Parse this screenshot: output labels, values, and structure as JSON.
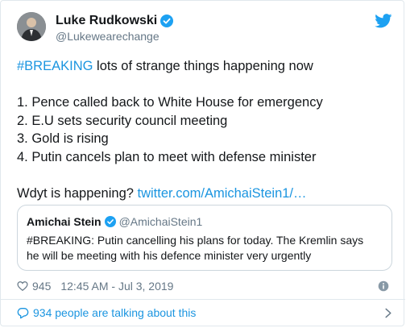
{
  "author": {
    "display_name": "Luke Rudkowski",
    "handle": "@Lukewearechange"
  },
  "tweet": {
    "hashtag": "#BREAKING",
    "lead_rest": " lots of strange things happening now",
    "items": [
      "1. Pence called back to White House for emergency",
      "2. E.U sets security council meeting",
      "3. Gold is rising",
      "4. Putin cancels plan to meet with defense minister"
    ],
    "question": "Wdyt is happening? ",
    "link": "twitter.com/AmichaiStein1/…"
  },
  "quoted_tweet": {
    "display_name": "Amichai Stein",
    "handle": "@AmichaiStein1",
    "text_line1": "#BREAKING: Putin cancelling his plans for today. The Kremlin says",
    "text_line2": "he will be meeting with his defence minister very urgently"
  },
  "meta": {
    "likes": "945",
    "timestamp": "12:45 AM - Jul 3, 2019"
  },
  "footer": {
    "talking": "934 people are talking about this"
  },
  "colors": {
    "accent": "#1b95e0",
    "text": "#14171a",
    "secondary": "#657786"
  },
  "icons": [
    "verified-badge-icon",
    "twitter-bird-icon",
    "heart-icon",
    "info-icon",
    "comment-bubble-icon",
    "chevron-right-icon"
  ]
}
